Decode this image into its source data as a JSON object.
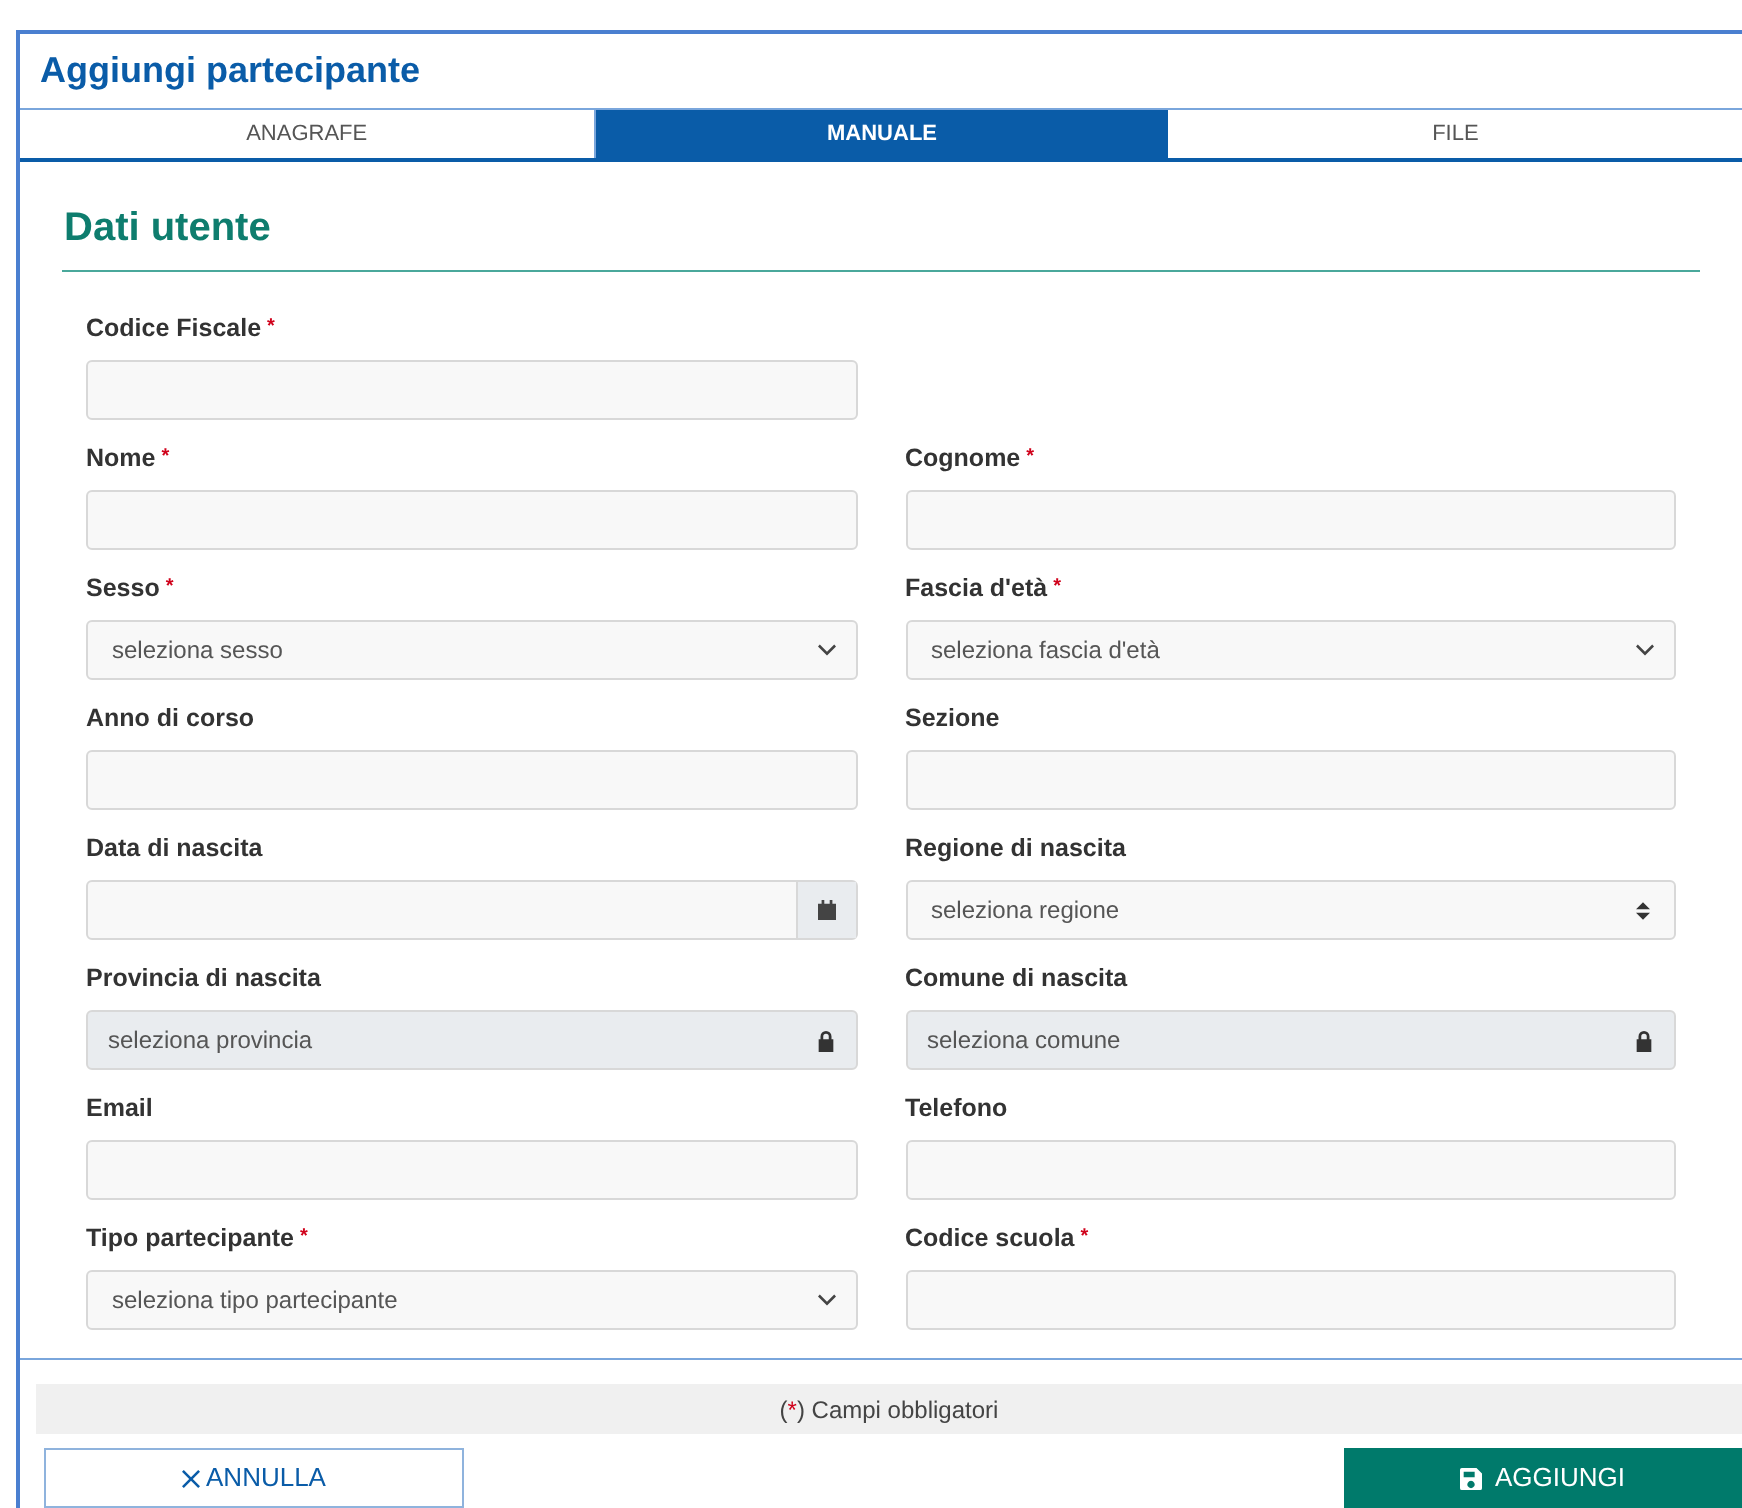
{
  "dialog": {
    "title": "Aggiungi partecipante"
  },
  "tabs": [
    {
      "label": "ANAGRAFE",
      "selected": false
    },
    {
      "label": "MANUALE",
      "selected": true
    },
    {
      "label": "FILE",
      "selected": false
    }
  ],
  "section_title": "Dati utente",
  "required_mark": "*",
  "rows": [
    [
      {
        "label": "Codice Fiscale",
        "required": true,
        "kind": "text"
      }
    ],
    [
      {
        "label": "Nome",
        "required": true,
        "kind": "text"
      },
      {
        "label": "Cognome",
        "required": true,
        "kind": "text"
      }
    ],
    [
      {
        "label": "Sesso",
        "required": true,
        "kind": "select",
        "placeholder": "seleziona sesso"
      },
      {
        "label": "Fascia d'età",
        "required": true,
        "kind": "select",
        "placeholder": "seleziona fascia d'età"
      }
    ],
    [
      {
        "label": "Anno di corso",
        "required": false,
        "kind": "text"
      },
      {
        "label": "Sezione",
        "required": false,
        "kind": "text"
      }
    ],
    [
      {
        "label": "Data di nascita",
        "required": false,
        "kind": "date"
      },
      {
        "label": "Regione di nascita",
        "required": false,
        "kind": "spinner",
        "placeholder": "seleziona regione"
      }
    ],
    [
      {
        "label": "Provincia di nascita",
        "required": false,
        "kind": "locked",
        "placeholder": "seleziona provincia"
      },
      {
        "label": "Comune di nascita",
        "required": false,
        "kind": "locked",
        "placeholder": "seleziona comune"
      }
    ],
    [
      {
        "label": "Email",
        "required": false,
        "kind": "text"
      },
      {
        "label": "Telefono",
        "required": false,
        "kind": "text"
      }
    ],
    [
      {
        "label": "Tipo partecipante",
        "required": true,
        "kind": "select",
        "placeholder": "seleziona tipo partecipante"
      },
      {
        "label": "Codice scuola",
        "required": true,
        "kind": "text"
      }
    ]
  ],
  "note": {
    "open": "(",
    "mark": "*",
    "text": ") Campi obbligatori"
  },
  "buttons": [
    {
      "label": "ANNULLA",
      "kind": "cancel"
    },
    {
      "label": "AGGIUNGI",
      "kind": "save"
    }
  ]
}
